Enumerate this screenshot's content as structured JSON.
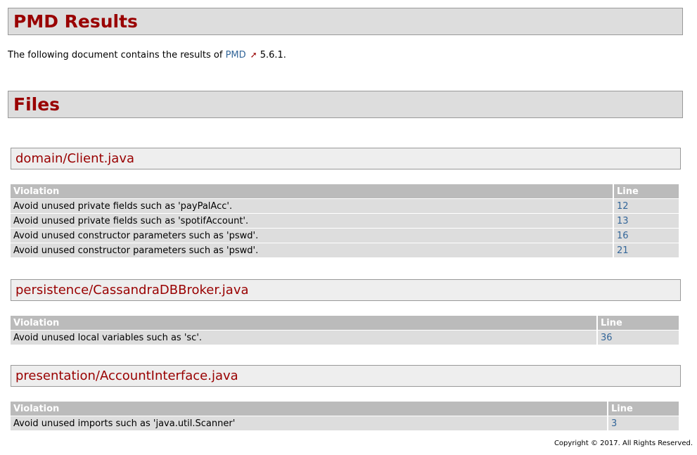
{
  "header": {
    "title": "PMD Results"
  },
  "intro": {
    "text": "The following document contains the results of ",
    "link_label": "PMD",
    "version": "5.6.1."
  },
  "files_section": {
    "title": "Files"
  },
  "files": [
    {
      "name": "domain/Client.java",
      "col_violation": "Violation",
      "col_line": "Line",
      "rows": [
        {
          "violation": "Avoid unused private fields such as 'payPalAcc'.",
          "line": "12"
        },
        {
          "violation": "Avoid unused private fields such as 'spotifAccount'.",
          "line": "13"
        },
        {
          "violation": "Avoid unused constructor parameters such as 'pswd'.",
          "line": "16"
        },
        {
          "violation": "Avoid unused constructor parameters such as 'pswd'.",
          "line": "21"
        }
      ]
    },
    {
      "name": "persistence/CassandraDBBroker.java",
      "col_violation": "Violation",
      "col_line": "Line",
      "rows": [
        {
          "violation": "Avoid unused local variables such as 'sc'.",
          "line": "36"
        }
      ]
    },
    {
      "name": "presentation/AccountInterface.java",
      "col_violation": "Violation",
      "col_line": "Line",
      "rows": [
        {
          "violation": "Avoid unused imports such as 'java.util.Scanner'",
          "line": "3"
        }
      ]
    }
  ],
  "footer": {
    "copyright": "Copyright © 2017. All Rights Reserved."
  },
  "colors": {
    "heading": "#990000",
    "link": "#336699",
    "header_bg": "#dddddd",
    "table_header_bg": "#bbbbbb"
  }
}
